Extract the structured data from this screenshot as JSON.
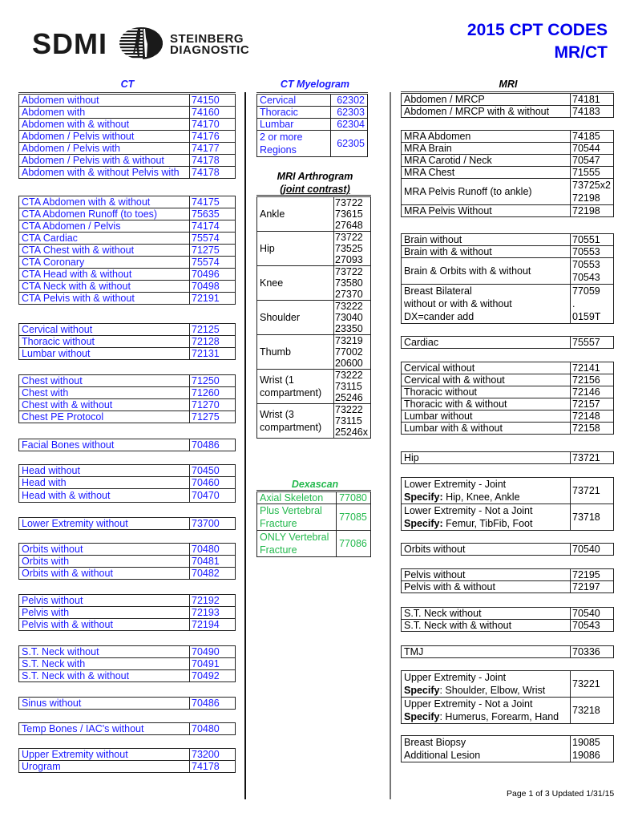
{
  "header": {
    "logo_text": "SDMI",
    "logo_sub_line1": "STEINBERG",
    "logo_sub_line2": "DIAGNOSTIC",
    "title_line1": "2015 CPT CODES",
    "title_line2": "MR/CT"
  },
  "colors": {
    "title_blue": "#0000ee",
    "ct_blue": "#1a1aff",
    "dexascan_green": "#22b84c"
  },
  "ct": {
    "title": "CT",
    "groups": [
      [
        {
          "name": "Abdomen without",
          "code": "74150"
        },
        {
          "name": "Abdomen with",
          "code": "74160"
        },
        {
          "name": "Abdomen with & without",
          "code": "74170"
        },
        {
          "name": "Abdomen / Pelvis without",
          "code": "74176"
        },
        {
          "name": "Abdomen / Pelvis with",
          "code": "74177"
        },
        {
          "name": "Abdomen / Pelvis with & without",
          "code": "74178"
        },
        {
          "name": "Abdomen with & without Pelvis with",
          "code": "74178"
        }
      ],
      [
        {
          "name": "CTA Abdomen with & without",
          "code": "74175"
        },
        {
          "name": "CTA Abdomen Runoff (to toes)",
          "code": "75635"
        },
        {
          "name": "CTA Abdomen / Pelvis",
          "code": "74174"
        },
        {
          "name": "CTA Cardiac",
          "code": "75574"
        },
        {
          "name": "CTA Chest with & without",
          "code": "71275"
        },
        {
          "name": "CTA Coronary",
          "code": "75574"
        },
        {
          "name": "CTA Head with & without",
          "code": "70496"
        },
        {
          "name": "CTA Neck with & without",
          "code": "70498"
        },
        {
          "name": "CTA Pelvis with & without",
          "code": "72191"
        }
      ],
      [
        {
          "name": "Cervical without",
          "code": "72125"
        },
        {
          "name": "Thoracic without",
          "code": "72128"
        },
        {
          "name": "Lumbar without",
          "code": "72131"
        }
      ],
      [
        {
          "name": "Chest without",
          "code": "71250"
        },
        {
          "name": "Chest with",
          "code": "71260"
        },
        {
          "name": "Chest with & without",
          "code": "71270"
        },
        {
          "name": "Chest PE Protocol",
          "code": "71275"
        }
      ],
      [
        {
          "name": "Facial Bones without",
          "code": "70486"
        }
      ],
      [
        {
          "name": "Head without",
          "code": "70450"
        },
        {
          "name": "Head with",
          "code": "70460"
        },
        {
          "name": "Head with & without",
          "code": "70470"
        }
      ],
      [
        {
          "name": "Lower Extremity without",
          "code": "73700"
        }
      ],
      [
        {
          "name": "Orbits without",
          "code": "70480"
        },
        {
          "name": "Orbits with",
          "code": "70481"
        },
        {
          "name": "Orbits with & without",
          "code": "70482"
        }
      ],
      [
        {
          "name": "Pelvis without",
          "code": "72192"
        },
        {
          "name": "Pelvis with",
          "code": "72193"
        },
        {
          "name": "Pelvis with & without",
          "code": "72194"
        }
      ],
      [
        {
          "name": "S.T. Neck without",
          "code": "70490"
        },
        {
          "name": "S.T. Neck with",
          "code": "70491"
        },
        {
          "name": "S.T. Neck with & without",
          "code": "70492"
        }
      ],
      [
        {
          "name": "Sinus without",
          "code": "70486"
        }
      ],
      [
        {
          "name": "Temp Bones / IAC's without",
          "code": "70480"
        }
      ],
      [
        {
          "name": "Upper Extremity without",
          "code": "73200"
        },
        {
          "name": "Urogram",
          "code": "74178"
        }
      ]
    ]
  },
  "ct_myelogram": {
    "title": "CT Myelogram",
    "rows": [
      {
        "name": "Cervical",
        "code": "62302"
      },
      {
        "name": "Thoracic",
        "code": "62303"
      },
      {
        "name": "Lumbar",
        "code": "62304"
      },
      {
        "name": "2 or more Regions",
        "code": "62305"
      }
    ]
  },
  "mri_arthrogram": {
    "title_line1": "MRI Arthrogram",
    "title_line2": "(joint contrast)",
    "rows": [
      {
        "name": "Ankle",
        "codes": [
          "73722",
          "73615",
          "27648"
        ]
      },
      {
        "name": "Hip",
        "codes": [
          "73722",
          "73525",
          "27093"
        ]
      },
      {
        "name": "Knee",
        "codes": [
          "73722",
          "73580",
          "27370"
        ]
      },
      {
        "name": "Shoulder",
        "codes": [
          "73222",
          "73040",
          "23350"
        ]
      },
      {
        "name": "Thumb",
        "codes": [
          "73219",
          "77002",
          "20600"
        ]
      },
      {
        "name": "Wrist (1 compartment)",
        "codes": [
          "73222",
          "73115",
          "25246"
        ]
      },
      {
        "name": "Wrist (3 compartment)",
        "codes": [
          "73222",
          "73115",
          "25246x"
        ]
      }
    ]
  },
  "dexascan": {
    "title": "Dexascan",
    "rows": [
      {
        "name": "Axial Skeleton",
        "code": "77080"
      },
      {
        "name": "Plus Vertebral Fracture",
        "code": "77085"
      },
      {
        "name": "ONLY Vertebral Fracture",
        "code": "77086"
      }
    ]
  },
  "mri": {
    "title": "MRI",
    "groups": [
      [
        {
          "name": "Abdomen / MRCP",
          "code": "74181"
        },
        {
          "name": "Abdomen / MRCP with & without",
          "code": "74183"
        }
      ],
      [
        {
          "name": "MRA Abdomen",
          "code": "74185"
        },
        {
          "name": "MRA Brain",
          "code": "70544"
        },
        {
          "name": "MRA Carotid / Neck",
          "code": "70547"
        },
        {
          "name": "MRA Chest",
          "code": "71555"
        },
        {
          "name": "MRA Pelvis Runoff (to ankle)",
          "code": "73725x2 72198"
        },
        {
          "name": "MRA Pelvis Without",
          "code": "72198"
        }
      ],
      [
        {
          "name": "Brain without",
          "code": "70551"
        },
        {
          "name": "Brain with & without",
          "code": "70553"
        },
        {
          "name": "Brain & Orbits with & without",
          "code": "70553 70543"
        },
        {
          "name": "Breast Bilateral without or with & without DX=cander add",
          "code": "77059 . 0159T"
        }
      ],
      [
        {
          "name": "Cardiac",
          "code": "75557"
        }
      ],
      [
        {
          "name": "Cervical without",
          "code": "72141"
        },
        {
          "name": "Cervical with & without",
          "code": "72156"
        },
        {
          "name": "Thoracic without",
          "code": "72146"
        },
        {
          "name": "Thoracic with & without",
          "code": "72157"
        },
        {
          "name": "Lumbar without",
          "code": "72148"
        },
        {
          "name": "Lumbar with & without",
          "code": "72158"
        }
      ],
      [
        {
          "name": "Hip",
          "code": "73721"
        }
      ],
      [
        {
          "name": "Lower Extremity - Joint",
          "specify_label": "Specify:",
          "specify": "Hip, Knee, Ankle",
          "code": "73721"
        },
        {
          "name": "Lower Extremity - Not a Joint",
          "specify_label": "Specify:",
          "specify": "Femur, TibFib, Foot",
          "code": "73718"
        }
      ],
      [
        {
          "name": "Orbits without",
          "code": "70540"
        }
      ],
      [
        {
          "name": "Pelvis without",
          "code": "72195"
        },
        {
          "name": "Pelvis with & without",
          "code": "72197"
        }
      ],
      [
        {
          "name": "S.T. Neck without",
          "code": "70540"
        },
        {
          "name": "S.T. Neck with & without",
          "code": "70543"
        }
      ],
      [
        {
          "name": "TMJ",
          "code": "70336"
        }
      ],
      [
        {
          "name": "Upper Extremity - Joint",
          "specify_label": "Specify",
          "specify": ": Shoulder, Elbow, Wrist",
          "code": "73221"
        },
        {
          "name": "Upper Extremity - Not a Joint",
          "specify_label": "Specify",
          "specify": ": Humerus, Forearm, Hand",
          "code": "73218"
        }
      ],
      [
        {
          "name": "Breast Biopsy Additional Lesion",
          "code": "19085 19086"
        }
      ]
    ]
  },
  "footer": "Page 1 of 3 Updated 1/31/15"
}
